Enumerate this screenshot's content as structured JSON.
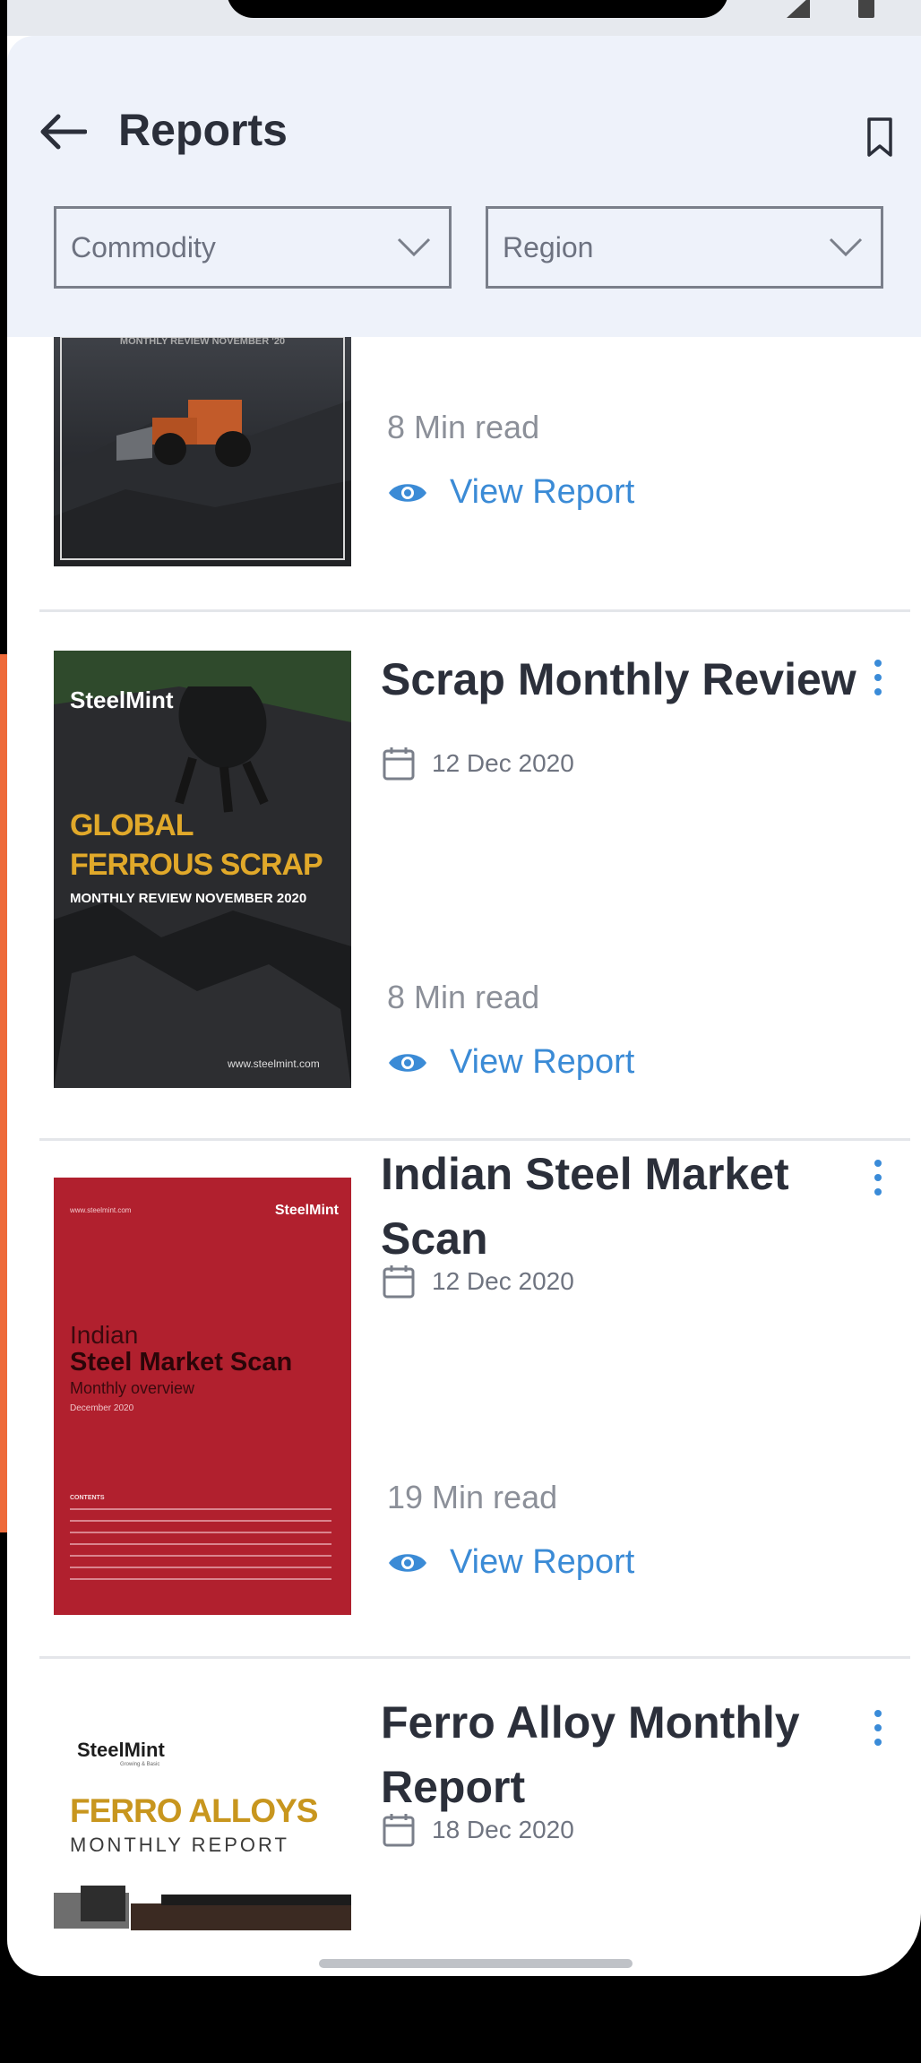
{
  "header": {
    "title": "Reports",
    "filters": [
      {
        "placeholder": "Commodity"
      },
      {
        "placeholder": "Region"
      }
    ]
  },
  "reports": [
    {
      "cover_text": "MONTHLY REVIEW NOVEMBER '20",
      "read_time": "8 Min read",
      "view_label": "View Report"
    },
    {
      "title": "Scrap Monthly Review",
      "date": "12 Dec 2020",
      "read_time": "8 Min read",
      "view_label": "View Report",
      "cover": {
        "brand": "SteelMint",
        "line1": "GLOBAL",
        "line2": "FERROUS SCRAP",
        "line3": "MONTHLY REVIEW NOVEMBER 2020",
        "url": "www.steelmint.com"
      }
    },
    {
      "title": "Indian Steel Market Scan",
      "date": "12 Dec 2020",
      "read_time": "19 Min read",
      "view_label": "View Report",
      "cover": {
        "url": "www.steelmint.com",
        "brand": "SteelMint",
        "line1": "Indian",
        "line2": "Steel Market Scan",
        "line3": "Monthly overview",
        "line4": "December 2020",
        "contents": "CONTENTS"
      }
    },
    {
      "title": "Ferro Alloy Monthly Report",
      "date": "18 Dec 2020",
      "cover": {
        "brand": "SteelMint",
        "tagline": "Growing & Basic",
        "line1": "FERRO ALLOYS",
        "line2": "MONTHLY REPORT"
      }
    }
  ],
  "colors": {
    "accent": "#3b8bd6",
    "header_bg": "#eef2fa",
    "cover_red": "#b1202e",
    "cover_gold": "#e1a92a",
    "ferro_gold": "#c8961e"
  }
}
